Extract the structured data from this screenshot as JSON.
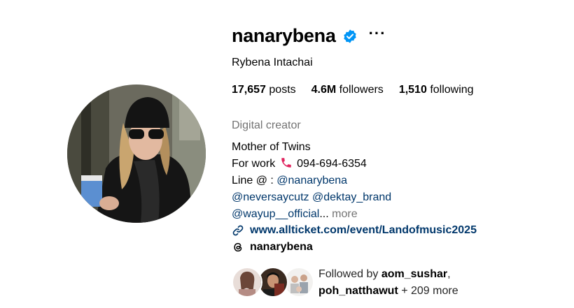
{
  "profile": {
    "username": "nanarybena",
    "verified": true,
    "more_glyph": "···",
    "full_name": "Rybena Intachai",
    "accent_color": "#0095f6",
    "link_color": "#00376b"
  },
  "stats": {
    "posts_count": "17,657",
    "posts_label": "posts",
    "followers_count": "4.6M",
    "followers_label": "followers",
    "following_count": "1,510",
    "following_label": "following"
  },
  "bio": {
    "category": "Digital creator",
    "line1": "Mother of Twins",
    "line2_prefix": "For work",
    "line2_phone": "094-694-6354",
    "line3_prefix": "Line @ :",
    "line3_mention": "@nanarybena",
    "line4_mention1": "@neversaycutz",
    "line4_mention2": "@dektay_brand",
    "line5_mention": "@wayup__official",
    "line5_ellipsis": "...",
    "more_label": "more"
  },
  "links": {
    "website": "www.allticket.com/event/Landofmusic2025",
    "threads_handle": "nanarybena",
    "link_icon": "link-icon",
    "threads_icon": "threads-icon"
  },
  "followed_by": {
    "prefix": "Followed by",
    "user1": "aom_sushar",
    "user2": "poh_natthawut",
    "suffix": "+ 209 more"
  }
}
